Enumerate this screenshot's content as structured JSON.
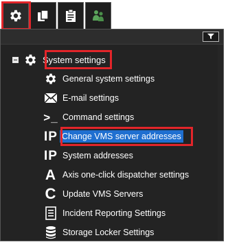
{
  "tabs": [
    {
      "icon": "gear-icon"
    },
    {
      "icon": "copy-pages-icon"
    },
    {
      "icon": "clipboard-icon"
    },
    {
      "icon": "people-icon"
    }
  ],
  "toolbar": {
    "filter_icon": "filter-funnel-icon"
  },
  "tree": {
    "root": {
      "label": "System settings",
      "icon": "gear-icon",
      "expanded": true
    },
    "items": [
      {
        "label": "General system settings",
        "icon": "gear-icon",
        "icon_text": ""
      },
      {
        "label": "E-mail settings",
        "icon": "envelope-icon",
        "icon_text": ""
      },
      {
        "label": "Command settings",
        "icon": "terminal-prompt-icon",
        "icon_text": ">_"
      },
      {
        "label": "Change VMS server addresses",
        "icon": "ip-icon",
        "icon_text": "IP",
        "selected": true
      },
      {
        "label": "System addresses",
        "icon": "ip-icon",
        "icon_text": "IP"
      },
      {
        "label": "Axis one-click dispatcher settings",
        "icon": "axis-logo-icon",
        "icon_text": "A"
      },
      {
        "label": "Update VMS Servers",
        "icon": "refresh-icon",
        "icon_text": "C"
      },
      {
        "label": "Incident Reporting Settings",
        "icon": "report-list-icon",
        "icon_text": ""
      },
      {
        "label": "Storage Locker Settings",
        "icon": "database-icon",
        "icon_text": ""
      }
    ]
  },
  "colors": {
    "panel_bg": "#232323",
    "highlight_red": "#e3252a",
    "selection_blue": "#1f6fd0",
    "text": "#ffffff",
    "people_icon_green": "#5aa35a"
  }
}
